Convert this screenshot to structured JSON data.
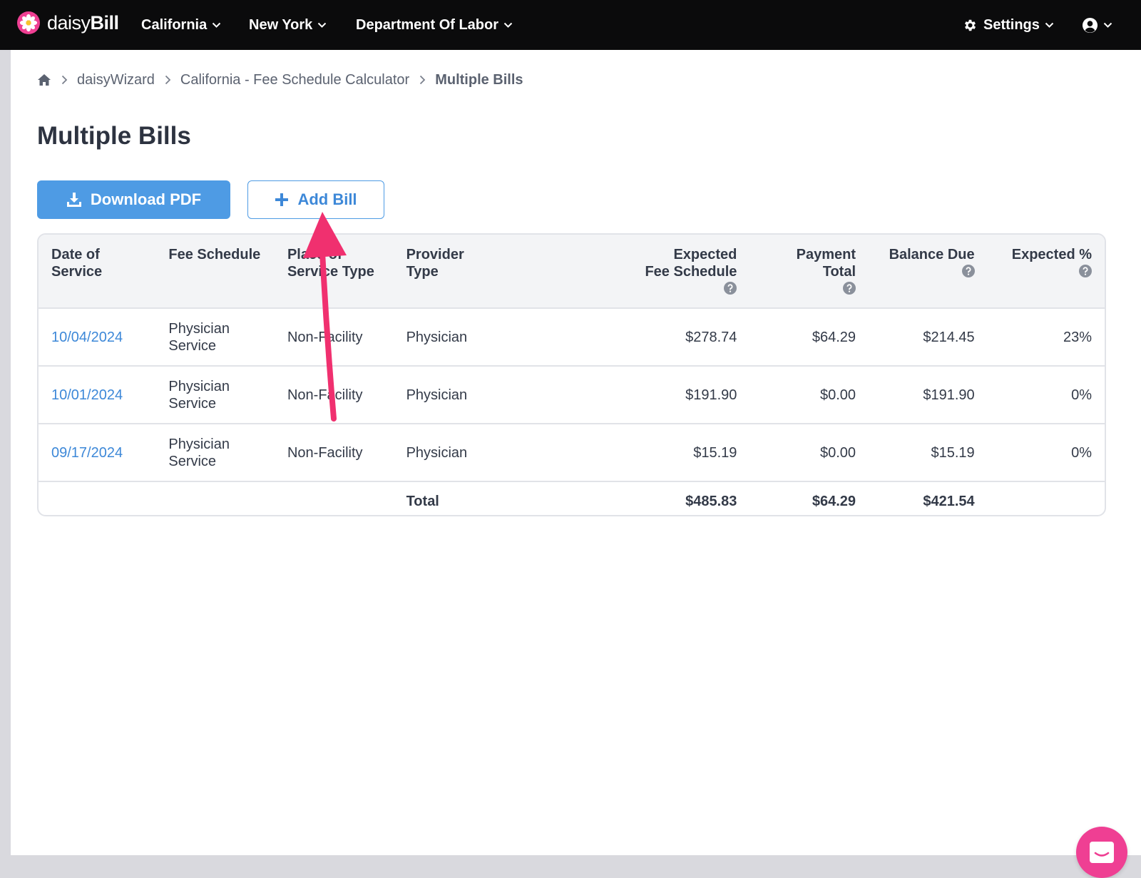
{
  "brand": {
    "name_light": "daisy",
    "name_bold": "Bill",
    "accent": "#ef3f93"
  },
  "nav": {
    "items": [
      {
        "label": "California"
      },
      {
        "label": "New York"
      },
      {
        "label": "Department Of Labor"
      }
    ],
    "settings_label": "Settings",
    "user_icon": "user-circle-icon"
  },
  "breadcrumb": {
    "home_icon": "home-icon",
    "items": [
      "daisyWizard",
      "California - Fee Schedule Calculator"
    ],
    "current": "Multiple Bills"
  },
  "page": {
    "title": "Multiple Bills",
    "download_label": "Download PDF",
    "add_label": "Add Bill"
  },
  "table": {
    "headers": {
      "date": "Date of Service",
      "fee_schedule": "Fee Schedule",
      "place_line1": "Place of",
      "place_line2": "Service Type",
      "provider": "Provider Type",
      "expected_line1": "Expected",
      "expected_line2": "Fee Schedule",
      "payment": "Payment Total",
      "balance": "Balance Due",
      "expected_pct": "Expected %"
    },
    "rows": [
      {
        "date": "10/04/2024",
        "fee_line1": "Physician",
        "fee_line2": "Service",
        "place": "Non-Facility",
        "provider": "Physician",
        "expected": "$278.74",
        "payment": "$64.29",
        "balance": "$214.45",
        "pct": "23%"
      },
      {
        "date": "10/01/2024",
        "fee_line1": "Physician",
        "fee_line2": "Service",
        "place": "Non-Facility",
        "provider": "Physician",
        "expected": "$191.90",
        "payment": "$0.00",
        "balance": "$191.90",
        "pct": "0%"
      },
      {
        "date": "09/17/2024",
        "fee_line1": "Physician",
        "fee_line2": "Service",
        "place": "Non-Facility",
        "provider": "Physician",
        "expected": "$15.19",
        "payment": "$0.00",
        "balance": "$15.19",
        "pct": "0%"
      }
    ],
    "total": {
      "label": "Total",
      "expected": "$485.83",
      "payment": "$64.29",
      "balance": "$421.54"
    }
  },
  "colors": {
    "primary": "#4e9be4",
    "link": "#3d88d8",
    "nav_bg": "#0b0b0c",
    "arrow": "#f0306f"
  }
}
